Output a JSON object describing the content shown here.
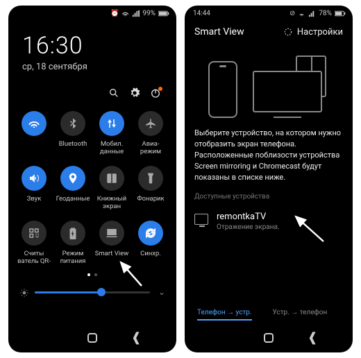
{
  "left": {
    "status": {
      "battery": "99%"
    },
    "clock": {
      "time": "16:30",
      "date": "ср, 18 сентября"
    },
    "tiles": [
      {
        "id": "wifi",
        "label": "",
        "on": true
      },
      {
        "id": "bluetooth",
        "label": "Bluetooth",
        "on": false
      },
      {
        "id": "mobile-data",
        "label": "Мобил.\nданные",
        "on": true
      },
      {
        "id": "airplane",
        "label": "Авиа-\nрежим",
        "on": false
      },
      {
        "id": "sound",
        "label": "Звук",
        "on": true
      },
      {
        "id": "location",
        "label": "Геоданные",
        "on": true
      },
      {
        "id": "book-screen",
        "label": "Книжный\nэкран",
        "on": false
      },
      {
        "id": "flashlight",
        "label": "Фонарик",
        "on": false
      },
      {
        "id": "qr",
        "label": "Считы\nватель QR-",
        "on": false
      },
      {
        "id": "power-mode",
        "label": "Режим\nпитания",
        "on": false
      },
      {
        "id": "smart-view",
        "label": "Smart View",
        "on": false
      },
      {
        "id": "sync",
        "label": "Синхр.",
        "on": true
      }
    ]
  },
  "right": {
    "status": {
      "time": "14:44",
      "battery": "78%"
    },
    "header": {
      "title": "Smart View",
      "settings": "Настройки"
    },
    "instruction": "Выберите устройство, на котором нужно отобразить экран телефона. Расположенные поблизости устройства Screen mirroring и Chromecast будут показаны в списке ниже.",
    "sectionLabel": "Доступные устройства",
    "device": {
      "name": "remontkaTV",
      "sub": "Отражение экрана."
    },
    "tabs": {
      "active": "Телефон → устр.",
      "inactive": "Устр. → телефон"
    }
  }
}
